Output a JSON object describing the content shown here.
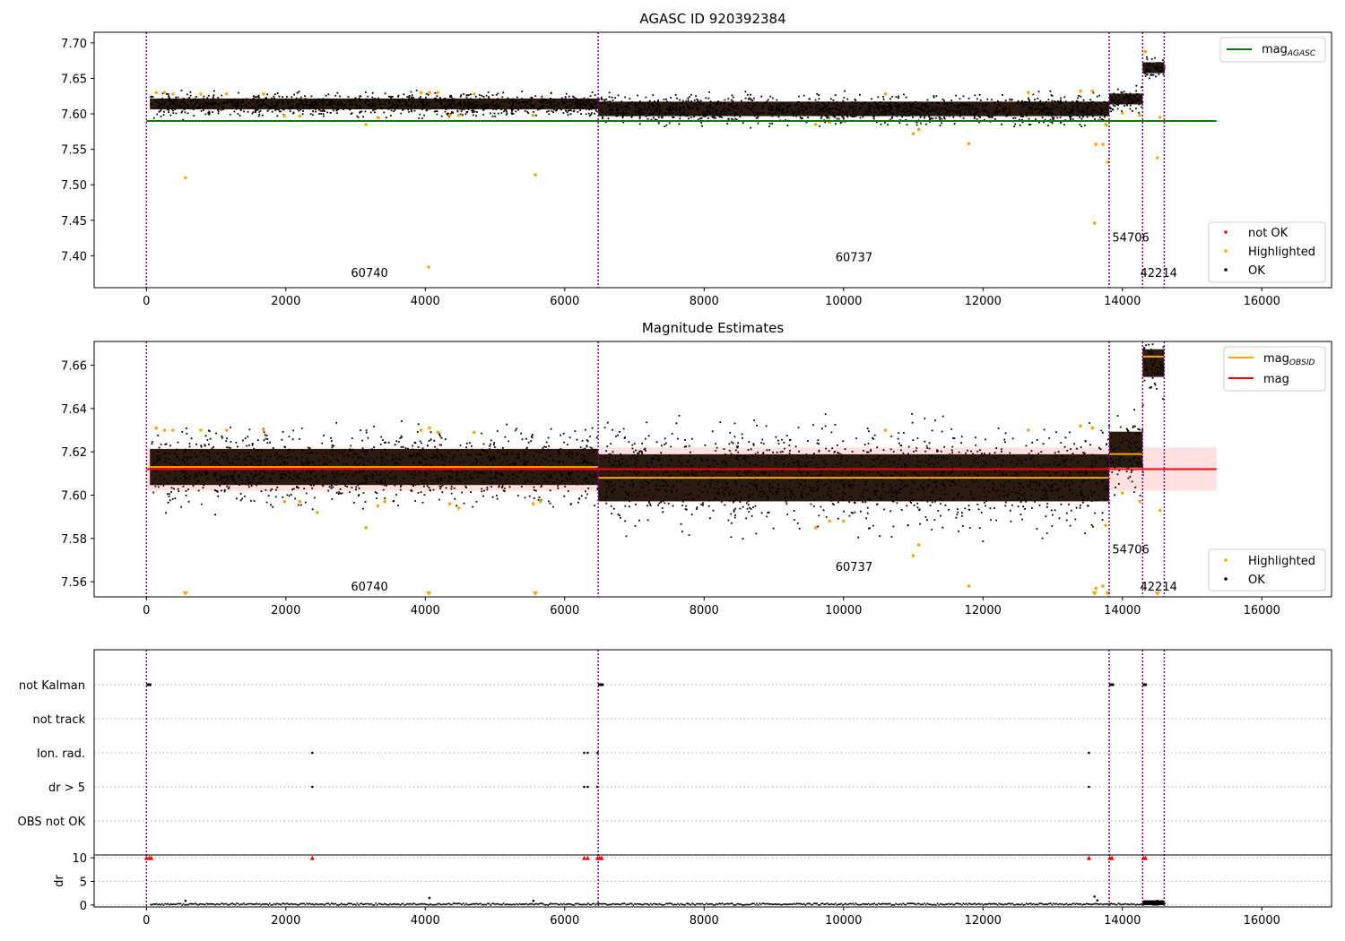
{
  "figure": {
    "top_title": "AGASC ID 920392384",
    "middle_title": "Magnitude Estimates"
  },
  "colors": {
    "ok": "#000000",
    "highlighted": "#ffa500",
    "not_ok": "#ff0000",
    "agasc_line": "#008000",
    "mag_line": "#ff0000",
    "obsid_line": "#ffa500",
    "mag_band": "#ffd6d6",
    "obs_separator": "#800080",
    "gridline": "#b0b0b0",
    "cloud_fill": "#2b1a10"
  },
  "chart_data": [
    {
      "type": "scatter",
      "title": "AGASC ID 920392384",
      "xlim": [
        -750,
        17000
      ],
      "ylim": [
        7.355,
        7.715
      ],
      "xticks": [
        0,
        2000,
        4000,
        6000,
        8000,
        10000,
        12000,
        14000,
        16000
      ],
      "yticks": [
        7.4,
        7.45,
        7.5,
        7.55,
        7.6,
        7.65,
        7.7
      ],
      "ytick_labels": [
        "7.40",
        "7.45",
        "7.50",
        "7.55",
        "7.60",
        "7.65",
        "7.70"
      ],
      "legend_upper": {
        "position": "upper right",
        "entries": [
          {
            "label": "mag",
            "sub": "AGASC"
          }
        ]
      },
      "legend_lower": {
        "position": "lower right",
        "entries": [
          "not OK",
          "Highlighted",
          "OK"
        ]
      },
      "agasc_mag": {
        "value": 7.59,
        "x": [
          0,
          15350
        ]
      },
      "observation_boundaries": [
        0,
        6480,
        13810,
        14290,
        14600
      ],
      "ok_bands": [
        {
          "x": [
            50,
            6480
          ],
          "center": 7.614,
          "half_width": 0.012
        },
        {
          "x": [
            6480,
            13810
          ],
          "center": 7.607,
          "half_width": 0.016
        },
        {
          "x": [
            13810,
            14290
          ],
          "center": 7.621,
          "half_width": 0.012
        },
        {
          "x": [
            14290,
            14600
          ],
          "center": 7.665,
          "half_width": 0.012
        }
      ],
      "highlighted_points": [
        [
          140,
          7.63
        ],
        [
          260,
          7.63
        ],
        [
          380,
          7.628
        ],
        [
          560,
          7.51
        ],
        [
          780,
          7.628
        ],
        [
          1150,
          7.628
        ],
        [
          1680,
          7.628
        ],
        [
          1980,
          7.597
        ],
        [
          2200,
          7.597
        ],
        [
          3150,
          7.585
        ],
        [
          3320,
          7.595
        ],
        [
          3940,
          7.63
        ],
        [
          4050,
          7.384
        ],
        [
          4060,
          7.63
        ],
        [
          4180,
          7.63
        ],
        [
          4350,
          7.598
        ],
        [
          4480,
          7.598
        ],
        [
          4700,
          7.628
        ],
        [
          5550,
          7.598
        ],
        [
          5580,
          7.514
        ],
        [
          9600,
          7.585
        ],
        [
          9800,
          7.588
        ],
        [
          10000,
          7.59
        ],
        [
          10600,
          7.628
        ],
        [
          11000,
          7.572
        ],
        [
          11080,
          7.578
        ],
        [
          11800,
          7.558
        ],
        [
          12650,
          7.63
        ],
        [
          13400,
          7.632
        ],
        [
          13570,
          7.632
        ],
        [
          13600,
          7.446
        ],
        [
          13620,
          7.557
        ],
        [
          13720,
          7.557
        ],
        [
          13760,
          7.585
        ],
        [
          13790,
          7.532
        ],
        [
          14000,
          7.601
        ],
        [
          14250,
          7.598
        ],
        [
          14330,
          7.688
        ],
        [
          14500,
          7.538
        ],
        [
          14540,
          7.595
        ]
      ],
      "obsid_labels": [
        {
          "text": "60740",
          "x": 3200,
          "y": 7.37
        },
        {
          "text": "60737",
          "x": 10150,
          "y": 7.392
        },
        {
          "text": "54706",
          "x": 14120,
          "y": 7.42
        },
        {
          "text": "42214",
          "x": 14520,
          "y": 7.37
        }
      ]
    },
    {
      "type": "scatter",
      "title": "Magnitude Estimates",
      "xlim": [
        -750,
        17000
      ],
      "ylim": [
        7.553,
        7.671
      ],
      "xticks": [
        0,
        2000,
        4000,
        6000,
        8000,
        10000,
        12000,
        14000,
        16000
      ],
      "yticks": [
        7.56,
        7.58,
        7.6,
        7.62,
        7.64,
        7.66
      ],
      "ytick_labels": [
        "7.56",
        "7.58",
        "7.60",
        "7.62",
        "7.64",
        "7.66"
      ],
      "legend_upper": {
        "position": "upper right",
        "entries": [
          {
            "label": "mag",
            "sub": "OBSID"
          },
          {
            "label": "mag",
            "sub": ""
          }
        ]
      },
      "legend_lower": {
        "position": "lower right",
        "entries": [
          "Highlighted",
          "OK"
        ]
      },
      "mag": {
        "value": 7.612,
        "band": [
          7.602,
          7.622
        ],
        "x": [
          0,
          15350
        ]
      },
      "obsid_mags": [
        {
          "x": [
            50,
            6480
          ],
          "value": 7.613
        },
        {
          "x": [
            6480,
            13810
          ],
          "value": 7.608
        },
        {
          "x": [
            13810,
            14290
          ],
          "value": 7.619
        },
        {
          "x": [
            14290,
            14600
          ],
          "value": 7.664
        }
      ],
      "observation_boundaries": [
        0,
        6480,
        13810,
        14290,
        14600
      ],
      "ok_bands": [
        {
          "x": [
            50,
            6480
          ],
          "center": 7.613,
          "half_width": 0.013
        },
        {
          "x": [
            6480,
            13810
          ],
          "center": 7.608,
          "half_width": 0.017
        },
        {
          "x": [
            13810,
            14290
          ],
          "center": 7.621,
          "half_width": 0.013
        },
        {
          "x": [
            14290,
            14600
          ],
          "center": 7.664,
          "half_width": 0.013
        }
      ],
      "highlighted_points": [
        [
          140,
          7.631
        ],
        [
          260,
          7.63
        ],
        [
          380,
          7.63
        ],
        [
          780,
          7.63
        ],
        [
          1150,
          7.63
        ],
        [
          1680,
          7.63
        ],
        [
          1980,
          7.597
        ],
        [
          2200,
          7.597
        ],
        [
          2450,
          7.592
        ],
        [
          3150,
          7.585
        ],
        [
          3320,
          7.595
        ],
        [
          3420,
          7.597
        ],
        [
          3940,
          7.63
        ],
        [
          4060,
          7.631
        ],
        [
          4180,
          7.629
        ],
        [
          4350,
          7.596
        ],
        [
          4480,
          7.594
        ],
        [
          4700,
          7.629
        ],
        [
          5550,
          7.596
        ],
        [
          5650,
          7.597
        ],
        [
          9600,
          7.585
        ],
        [
          9800,
          7.588
        ],
        [
          10000,
          7.588
        ],
        [
          10600,
          7.63
        ],
        [
          11000,
          7.572
        ],
        [
          11080,
          7.577
        ],
        [
          11800,
          7.558
        ],
        [
          12650,
          7.63
        ],
        [
          13400,
          7.632
        ],
        [
          13570,
          7.631
        ],
        [
          13620,
          7.557
        ],
        [
          13720,
          7.558
        ],
        [
          13760,
          7.586
        ],
        [
          14000,
          7.601
        ],
        [
          14250,
          7.597
        ],
        [
          14540,
          7.593
        ]
      ],
      "clipped_points_x": [
        560,
        4050,
        5580,
        13600,
        13790,
        14500
      ],
      "obsid_labels": [
        {
          "text": "60740",
          "x": 3200,
          "y": 7.556
        },
        {
          "text": "60737",
          "x": 10150,
          "y": 7.565
        },
        {
          "text": "54706",
          "x": 14120,
          "y": 7.573
        },
        {
          "text": "42214",
          "x": 14520,
          "y": 7.556
        }
      ]
    },
    {
      "type": "scatter",
      "title": "",
      "xlim": [
        -750,
        17000
      ],
      "xticks": [
        0,
        2000,
        4000,
        6000,
        8000,
        10000,
        12000,
        14000,
        16000
      ],
      "flag_rows": [
        "not Kalman",
        "not track",
        "Ion. rad.",
        "dr > 5",
        "OBS not OK"
      ],
      "flag_points": [
        {
          "row": "not Kalman",
          "x": [
            0,
            70
          ]
        },
        {
          "row": "not Kalman",
          "x": [
            6480,
            6560
          ]
        },
        {
          "row": "not Kalman",
          "x": [
            13810,
            13880
          ]
        },
        {
          "row": "not Kalman",
          "x": [
            14290,
            14350
          ]
        },
        {
          "row": "Ion. rad.",
          "x": [
            2380
          ]
        },
        {
          "row": "Ion. rad.",
          "x": [
            6280,
            6330,
            6470
          ]
        },
        {
          "row": "Ion. rad.",
          "x": [
            13520
          ]
        },
        {
          "row": "dr > 5",
          "x": [
            2380
          ]
        },
        {
          "row": "dr > 5",
          "x": [
            6280,
            6330,
            6470
          ]
        },
        {
          "row": "dr > 5",
          "x": [
            13520
          ]
        }
      ],
      "observation_boundaries": [
        0,
        6480,
        13810,
        14290,
        14600
      ],
      "dr": {
        "ylabel": "dr",
        "ylim": [
          -0.4,
          10.6
        ],
        "yticks": [
          0,
          5,
          10
        ],
        "clip_markers_x": [
          0,
          40,
          70,
          2380,
          6280,
          6330,
          6470,
          6500,
          6530,
          13520,
          13820,
          13850,
          14300,
          14330
        ],
        "spikes": [
          [
            560,
            0.9
          ],
          [
            4060,
            1.5
          ],
          [
            5550,
            0.9
          ],
          [
            13600,
            1.8
          ],
          [
            13640,
            1.0
          ],
          [
            14500,
            0.9
          ]
        ]
      }
    }
  ]
}
